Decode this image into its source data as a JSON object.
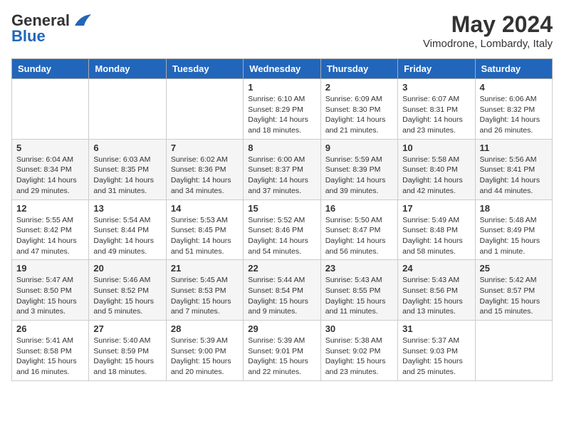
{
  "logo": {
    "part1": "General",
    "part2": "Blue"
  },
  "header": {
    "month_year": "May 2024",
    "location": "Vimodrone, Lombardy, Italy"
  },
  "weekdays": [
    "Sunday",
    "Monday",
    "Tuesday",
    "Wednesday",
    "Thursday",
    "Friday",
    "Saturday"
  ],
  "weeks": [
    [
      {
        "day": "",
        "info": ""
      },
      {
        "day": "",
        "info": ""
      },
      {
        "day": "",
        "info": ""
      },
      {
        "day": "1",
        "info": "Sunrise: 6:10 AM\nSunset: 8:29 PM\nDaylight: 14 hours\nand 18 minutes."
      },
      {
        "day": "2",
        "info": "Sunrise: 6:09 AM\nSunset: 8:30 PM\nDaylight: 14 hours\nand 21 minutes."
      },
      {
        "day": "3",
        "info": "Sunrise: 6:07 AM\nSunset: 8:31 PM\nDaylight: 14 hours\nand 23 minutes."
      },
      {
        "day": "4",
        "info": "Sunrise: 6:06 AM\nSunset: 8:32 PM\nDaylight: 14 hours\nand 26 minutes."
      }
    ],
    [
      {
        "day": "5",
        "info": "Sunrise: 6:04 AM\nSunset: 8:34 PM\nDaylight: 14 hours\nand 29 minutes."
      },
      {
        "day": "6",
        "info": "Sunrise: 6:03 AM\nSunset: 8:35 PM\nDaylight: 14 hours\nand 31 minutes."
      },
      {
        "day": "7",
        "info": "Sunrise: 6:02 AM\nSunset: 8:36 PM\nDaylight: 14 hours\nand 34 minutes."
      },
      {
        "day": "8",
        "info": "Sunrise: 6:00 AM\nSunset: 8:37 PM\nDaylight: 14 hours\nand 37 minutes."
      },
      {
        "day": "9",
        "info": "Sunrise: 5:59 AM\nSunset: 8:39 PM\nDaylight: 14 hours\nand 39 minutes."
      },
      {
        "day": "10",
        "info": "Sunrise: 5:58 AM\nSunset: 8:40 PM\nDaylight: 14 hours\nand 42 minutes."
      },
      {
        "day": "11",
        "info": "Sunrise: 5:56 AM\nSunset: 8:41 PM\nDaylight: 14 hours\nand 44 minutes."
      }
    ],
    [
      {
        "day": "12",
        "info": "Sunrise: 5:55 AM\nSunset: 8:42 PM\nDaylight: 14 hours\nand 47 minutes."
      },
      {
        "day": "13",
        "info": "Sunrise: 5:54 AM\nSunset: 8:44 PM\nDaylight: 14 hours\nand 49 minutes."
      },
      {
        "day": "14",
        "info": "Sunrise: 5:53 AM\nSunset: 8:45 PM\nDaylight: 14 hours\nand 51 minutes."
      },
      {
        "day": "15",
        "info": "Sunrise: 5:52 AM\nSunset: 8:46 PM\nDaylight: 14 hours\nand 54 minutes."
      },
      {
        "day": "16",
        "info": "Sunrise: 5:50 AM\nSunset: 8:47 PM\nDaylight: 14 hours\nand 56 minutes."
      },
      {
        "day": "17",
        "info": "Sunrise: 5:49 AM\nSunset: 8:48 PM\nDaylight: 14 hours\nand 58 minutes."
      },
      {
        "day": "18",
        "info": "Sunrise: 5:48 AM\nSunset: 8:49 PM\nDaylight: 15 hours\nand 1 minute."
      }
    ],
    [
      {
        "day": "19",
        "info": "Sunrise: 5:47 AM\nSunset: 8:50 PM\nDaylight: 15 hours\nand 3 minutes."
      },
      {
        "day": "20",
        "info": "Sunrise: 5:46 AM\nSunset: 8:52 PM\nDaylight: 15 hours\nand 5 minutes."
      },
      {
        "day": "21",
        "info": "Sunrise: 5:45 AM\nSunset: 8:53 PM\nDaylight: 15 hours\nand 7 minutes."
      },
      {
        "day": "22",
        "info": "Sunrise: 5:44 AM\nSunset: 8:54 PM\nDaylight: 15 hours\nand 9 minutes."
      },
      {
        "day": "23",
        "info": "Sunrise: 5:43 AM\nSunset: 8:55 PM\nDaylight: 15 hours\nand 11 minutes."
      },
      {
        "day": "24",
        "info": "Sunrise: 5:43 AM\nSunset: 8:56 PM\nDaylight: 15 hours\nand 13 minutes."
      },
      {
        "day": "25",
        "info": "Sunrise: 5:42 AM\nSunset: 8:57 PM\nDaylight: 15 hours\nand 15 minutes."
      }
    ],
    [
      {
        "day": "26",
        "info": "Sunrise: 5:41 AM\nSunset: 8:58 PM\nDaylight: 15 hours\nand 16 minutes."
      },
      {
        "day": "27",
        "info": "Sunrise: 5:40 AM\nSunset: 8:59 PM\nDaylight: 15 hours\nand 18 minutes."
      },
      {
        "day": "28",
        "info": "Sunrise: 5:39 AM\nSunset: 9:00 PM\nDaylight: 15 hours\nand 20 minutes."
      },
      {
        "day": "29",
        "info": "Sunrise: 5:39 AM\nSunset: 9:01 PM\nDaylight: 15 hours\nand 22 minutes."
      },
      {
        "day": "30",
        "info": "Sunrise: 5:38 AM\nSunset: 9:02 PM\nDaylight: 15 hours\nand 23 minutes."
      },
      {
        "day": "31",
        "info": "Sunrise: 5:37 AM\nSunset: 9:03 PM\nDaylight: 15 hours\nand 25 minutes."
      },
      {
        "day": "",
        "info": ""
      }
    ]
  ]
}
